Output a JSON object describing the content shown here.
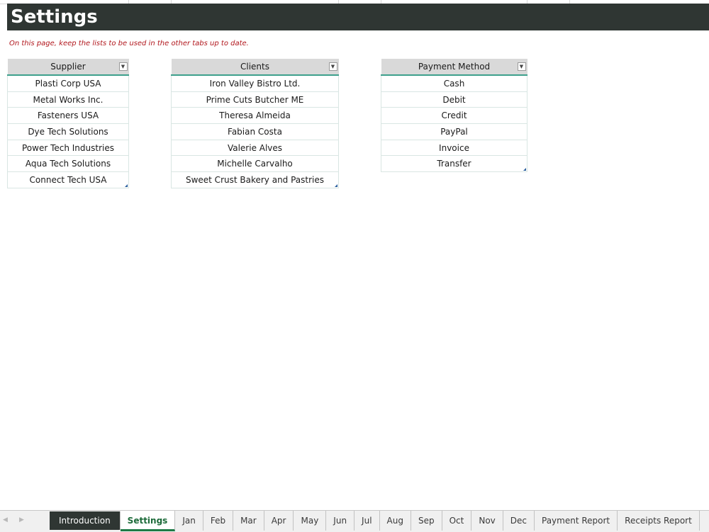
{
  "sheet": {
    "title": "Settings",
    "note": "On this page, keep the lists to be used in the other tabs up to date."
  },
  "tables": {
    "supplier": {
      "header": "Supplier",
      "rows": [
        "Plasti Corp USA",
        "Metal Works Inc.",
        "Fasteners USA",
        "Dye Tech Solutions",
        "Power Tech Industries",
        "Aqua Tech Solutions",
        "Connect Tech USA"
      ]
    },
    "clients": {
      "header": "Clients",
      "rows": [
        "Iron Valley Bistro Ltd.",
        "Prime Cuts Butcher ME",
        "Theresa Almeida",
        "Fabian Costa",
        "Valerie Alves",
        "Michelle Carvalho",
        "Sweet Crust Bakery and Pastries"
      ]
    },
    "payment": {
      "header": "Payment Method",
      "rows": [
        "Cash",
        "Debit",
        "Credit",
        "PayPal",
        "Invoice",
        "Transfer"
      ]
    }
  },
  "sheet_tabs": [
    "Introduction",
    "Settings",
    "Jan",
    "Feb",
    "Mar",
    "Apr",
    "May",
    "Jun",
    "Jul",
    "Aug",
    "Sep",
    "Oct",
    "Nov",
    "Dec",
    "Payment Report",
    "Receipts Report"
  ],
  "active_tab": "Settings",
  "icons": {
    "filter": "filter-dropdown-icon",
    "nav_prev": "chevron-left-icon",
    "nav_next": "chevron-right-icon"
  },
  "colors": {
    "banner": "#2f3633",
    "note": "#b1161c",
    "header_bg": "#d9d9d9",
    "header_underline": "#3da08c",
    "active_tab_text": "#1d6b3a"
  }
}
